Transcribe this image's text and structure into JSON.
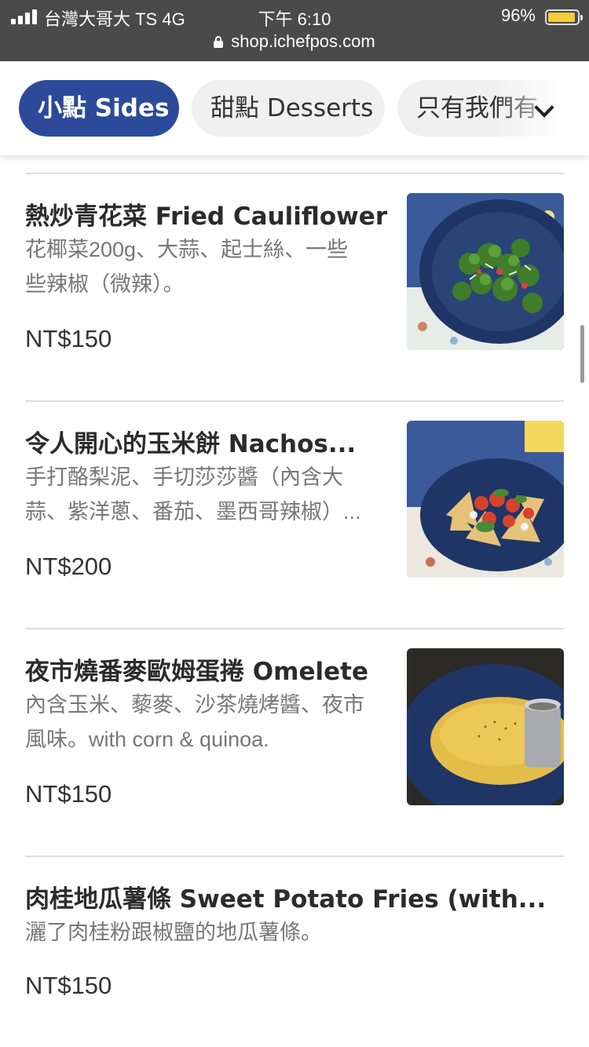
{
  "status_bar": {
    "carrier": "台灣大哥大 TS   4G",
    "time": "下午 6:10",
    "battery": "96%",
    "url": "shop.ichefpos.com"
  },
  "tabs": [
    {
      "label": "小點 Sides",
      "active": true
    },
    {
      "label": "甜點 Desserts",
      "active": false
    },
    {
      "label": "只有我們有",
      "active": false
    }
  ],
  "items": [
    {
      "title": "熱炒青花菜 Fried Cauliflower",
      "desc_lines": [
        "花椰菜200g、大蒜、起士絲、一些",
        "些辣椒（微辣）。"
      ],
      "price": "NT$150",
      "image": "fried-cauliflower"
    },
    {
      "title": "令人開心的玉米餅 Nachos...",
      "desc_lines": [
        "手打酪梨泥、手切莎莎醬（內含大",
        "蒜、紫洋蔥、番茄、墨西哥辣椒）..."
      ],
      "price": "NT$200",
      "image": "nachos"
    },
    {
      "title": "夜市燒番麥歐姆蛋捲 Omelete",
      "desc_lines": [
        "內含玉米、藜麥、沙茶燒烤醬、夜市",
        "風味。with corn & quinoa."
      ],
      "price": "NT$150",
      "image": "omelete"
    },
    {
      "title": "肉桂地瓜薯條 Sweet Potato Fries (with...",
      "desc_lines": [
        "灑了肉桂粉跟椒鹽的地瓜薯條。"
      ],
      "price": "NT$150"
    }
  ],
  "colors": {
    "status_bg": "#4a4a4a",
    "accent": "#2d4a9a",
    "tab_bg": "#f0f0f0",
    "battery": "#f5cc3a"
  }
}
